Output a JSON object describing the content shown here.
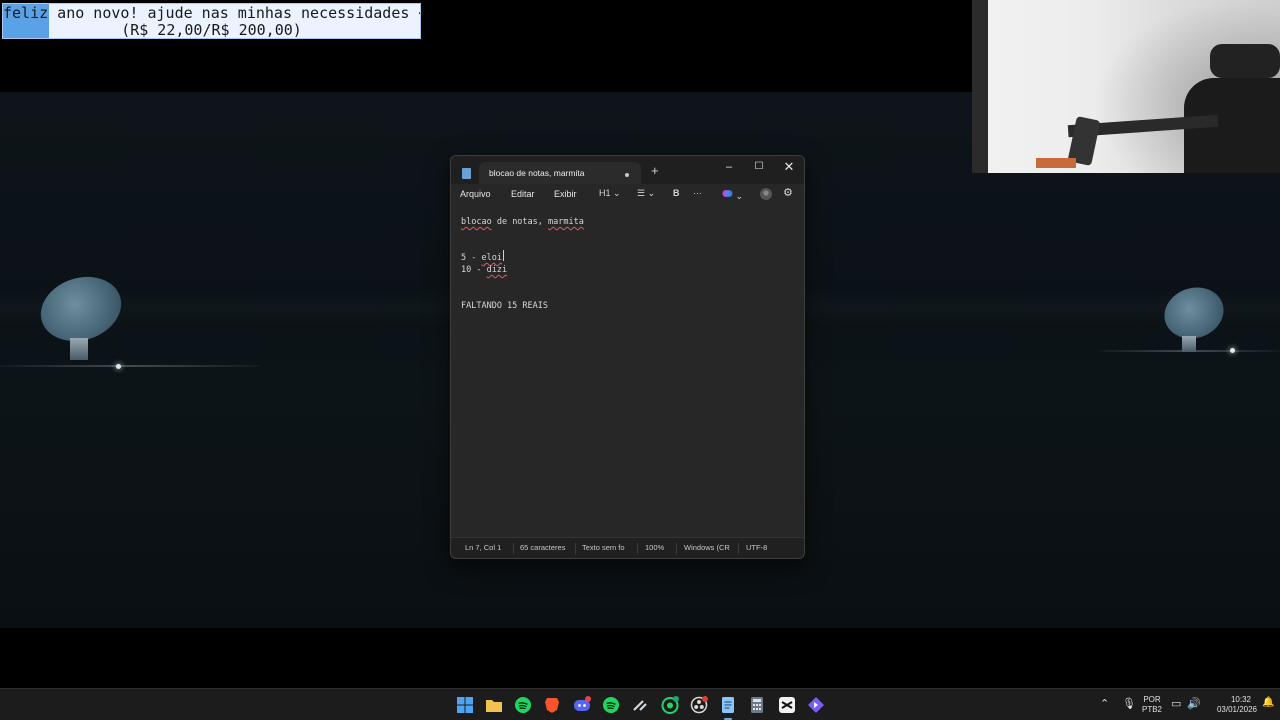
{
  "banner": {
    "line1": "feliz ano novo! ajude nas minhas necessidades <3",
    "line2": "(R$ 22,00/R$ 200,00)",
    "progress": 0.11
  },
  "notepad": {
    "tab_title": "blocao de notas, marmita",
    "new_tab_glyph": "+",
    "window_controls": {
      "minimize": "–",
      "maximize": "☐",
      "close": "✕"
    },
    "menu": {
      "file": "Arquivo",
      "edit": "Editar",
      "view": "Exibir"
    },
    "toolbar": {
      "heading": "H1",
      "bold": "B",
      "more": "···"
    },
    "lines": [
      "blocao de notas, marmita",
      "",
      "",
      "5 - eloi",
      "10 - dizi",
      "",
      "",
      "FALTANDO 15 REAIS"
    ],
    "status": {
      "position": "Ln 7, Col 1",
      "chars": "65 caracteres",
      "format": "Texto sem fo",
      "zoom": "100%",
      "line_ending": "Windows (CR",
      "encoding": "UTF-8"
    }
  },
  "taskbar": {
    "lang_top": "POR",
    "lang_bottom": "PTB2",
    "time": "10:32",
    "date": "03/01/2026",
    "icons": [
      "windows-start-icon",
      "file-explorer-icon",
      "spotify-icon",
      "brave-browser-icon",
      "discord-icon",
      "spotify-icon",
      "steam-icon",
      "whatsapp-icon",
      "obs-icon",
      "notepad-icon",
      "calculator-icon",
      "capcut-icon",
      "app-icon"
    ]
  }
}
